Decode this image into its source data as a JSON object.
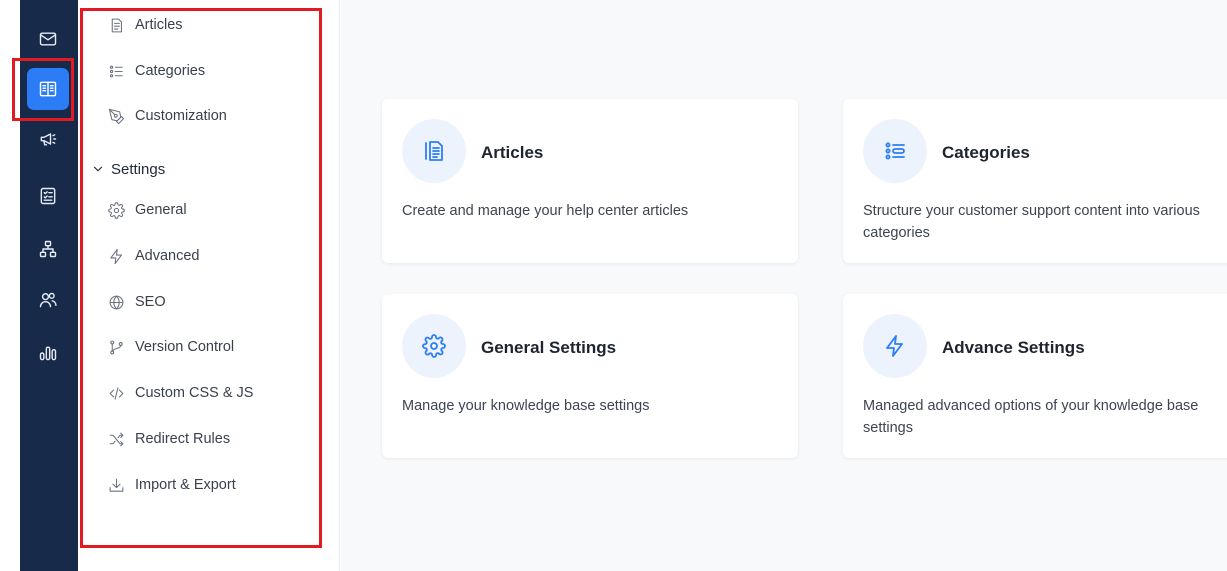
{
  "rail": {
    "items": [
      {
        "name": "mail-icon",
        "active": false
      },
      {
        "name": "book-icon",
        "active": true
      },
      {
        "name": "megaphone-icon",
        "active": false
      },
      {
        "name": "checklist-icon",
        "active": false
      },
      {
        "name": "sitemap-icon",
        "active": false
      },
      {
        "name": "users-icon",
        "active": false
      },
      {
        "name": "bar-chart-icon",
        "active": false
      }
    ]
  },
  "subnav": {
    "top_items": [
      {
        "label": "Articles",
        "icon": "document-icon"
      },
      {
        "label": "Categories",
        "icon": "list-icon"
      },
      {
        "label": "Customization",
        "icon": "pen-tool-icon"
      }
    ],
    "section": {
      "label": "Settings",
      "icon": "chevron-down-icon"
    },
    "settings_items": [
      {
        "label": "General",
        "icon": "gear-icon"
      },
      {
        "label": "Advanced",
        "icon": "lightning-icon"
      },
      {
        "label": "SEO",
        "icon": "globe-icon"
      },
      {
        "label": "Version Control",
        "icon": "git-branch-icon"
      },
      {
        "label": "Custom CSS & JS",
        "icon": "code-icon"
      },
      {
        "label": "Redirect Rules",
        "icon": "shuffle-icon"
      },
      {
        "label": "Import & Export",
        "icon": "download-icon"
      }
    ]
  },
  "cards": [
    {
      "title": "Articles",
      "description": "Create and manage your help center articles",
      "icon": "document-lines-icon"
    },
    {
      "title": "Categories",
      "description": "Structure your customer support content into various categories",
      "icon": "list-icon"
    },
    {
      "title": "General Settings",
      "description": "Manage your knowledge base settings",
      "icon": "gear-icon"
    },
    {
      "title": "Advance Settings",
      "description": "Managed advanced options of your knowledge base settings",
      "icon": "lightning-icon"
    }
  ],
  "colors": {
    "rail_bg": "#172a4a",
    "accent": "#2c7df5",
    "highlight": "#e21b23",
    "main_bg": "#f8f9fa"
  }
}
